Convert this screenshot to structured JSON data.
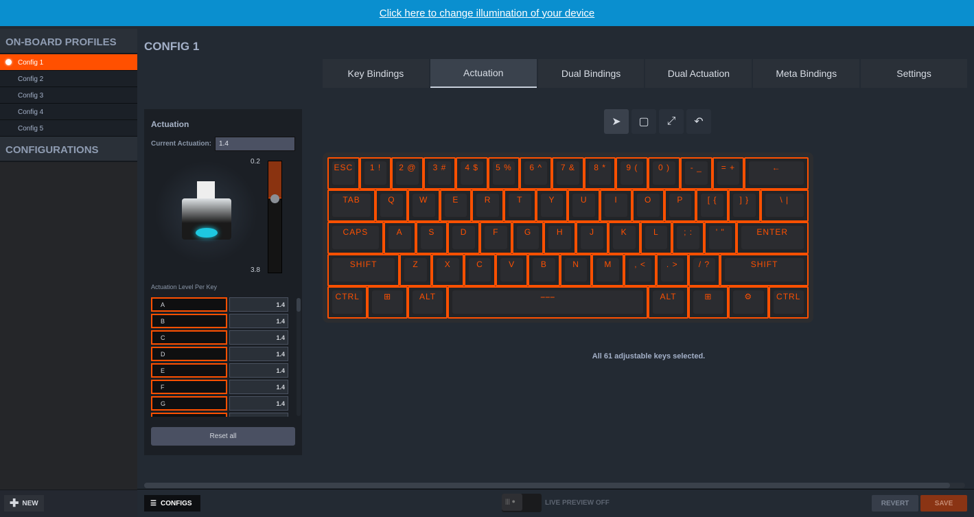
{
  "banner": {
    "link": "Click here to change illumination of your device"
  },
  "sidebar": {
    "profiles_title": "ON-BOARD PROFILES",
    "profiles": [
      "Config 1",
      "Config 2",
      "Config 3",
      "Config 4",
      "Config 5"
    ],
    "active_profile": 0,
    "configurations_title": "CONFIGURATIONS",
    "new_label": "NEW"
  },
  "main": {
    "title": "CONFIG 1",
    "tabs": [
      "Key Bindings",
      "Actuation",
      "Dual Bindings",
      "Dual Actuation",
      "Meta Bindings",
      "Settings"
    ],
    "active_tab": 1
  },
  "actuation": {
    "title": "Actuation",
    "current_label": "Current Actuation:",
    "current_value": "1.4",
    "slider_min": "0.2",
    "slider_max": "3.8",
    "slider_value": 1.4,
    "per_key_label": "Actuation Level Per Key",
    "keys": [
      {
        "k": "A",
        "v": "1.4"
      },
      {
        "k": "B",
        "v": "1.4"
      },
      {
        "k": "C",
        "v": "1.4"
      },
      {
        "k": "D",
        "v": "1.4"
      },
      {
        "k": "E",
        "v": "1.4"
      },
      {
        "k": "F",
        "v": "1.4"
      },
      {
        "k": "G",
        "v": "1.4"
      },
      {
        "k": "",
        "v": ""
      }
    ],
    "reset_label": "Reset all"
  },
  "tools": [
    "select-arrow-icon",
    "rectangle-select-icon",
    "expand-icon",
    "undo-icon"
  ],
  "keyboard": {
    "accent": "#ff5000",
    "rows": [
      [
        [
          "ESC",
          1
        ],
        [
          "1 !",
          1
        ],
        [
          "2 @",
          1
        ],
        [
          "3 #",
          1
        ],
        [
          "4 $",
          1
        ],
        [
          "5 %",
          1
        ],
        [
          "6 ^",
          1
        ],
        [
          "7 &",
          1
        ],
        [
          "8 *",
          1
        ],
        [
          "9 (",
          1
        ],
        [
          "0 )",
          1
        ],
        [
          "- _",
          1
        ],
        [
          "= +",
          1
        ],
        [
          "←",
          2
        ]
      ],
      [
        [
          "TAB",
          1.5
        ],
        [
          "Q",
          1
        ],
        [
          "W",
          1
        ],
        [
          "E",
          1
        ],
        [
          "R",
          1
        ],
        [
          "T",
          1
        ],
        [
          "Y",
          1
        ],
        [
          "U",
          1
        ],
        [
          "I",
          1
        ],
        [
          "O",
          1
        ],
        [
          "P",
          1
        ],
        [
          "[ {",
          1
        ],
        [
          "] }",
          1
        ],
        [
          "\\ |",
          1.5
        ]
      ],
      [
        [
          "CAPS",
          1.75
        ],
        [
          "A",
          1
        ],
        [
          "S",
          1
        ],
        [
          "D",
          1
        ],
        [
          "F",
          1
        ],
        [
          "G",
          1
        ],
        [
          "H",
          1
        ],
        [
          "J",
          1
        ],
        [
          "K",
          1
        ],
        [
          "L",
          1
        ],
        [
          "; :",
          1
        ],
        [
          "' \"",
          1
        ],
        [
          "ENTER",
          2.25
        ]
      ],
      [
        [
          "SHIFT",
          2.25
        ],
        [
          "Z",
          1
        ],
        [
          "X",
          1
        ],
        [
          "C",
          1
        ],
        [
          "V",
          1
        ],
        [
          "B",
          1
        ],
        [
          "N",
          1
        ],
        [
          "M",
          1
        ],
        [
          ", <",
          1
        ],
        [
          ". >",
          1
        ],
        [
          "/ ?",
          1
        ],
        [
          "SHIFT",
          2.75
        ]
      ],
      [
        [
          "CTRL",
          1.25
        ],
        [
          "⊞",
          1.25
        ],
        [
          "ALT",
          1.25
        ],
        [
          "⎯⎯⎯",
          6.25
        ],
        [
          "ALT",
          1.25
        ],
        [
          "⊞",
          1.25
        ],
        [
          "⚙",
          1.25
        ],
        [
          "CTRL",
          1.25
        ]
      ]
    ]
  },
  "status": "All 61 adjustable keys selected.",
  "footer": {
    "configs_label": "CONFIGS",
    "live_preview": "LIVE PREVIEW OFF",
    "revert": "REVERT",
    "save": "SAVE"
  }
}
